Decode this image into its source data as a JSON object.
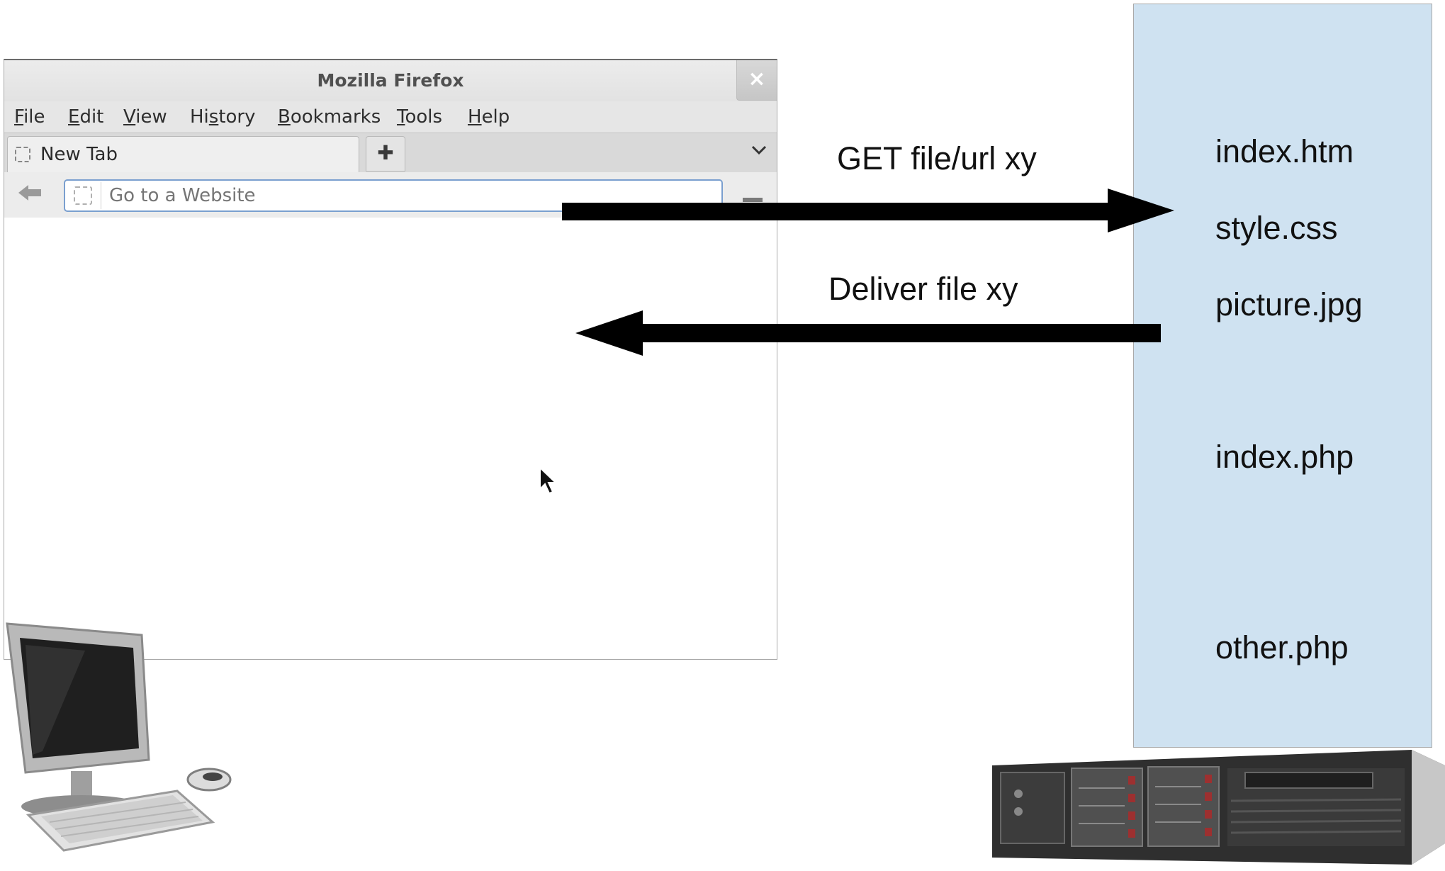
{
  "browser": {
    "window_title": "Mozilla Firefox",
    "close_glyph": "×",
    "menu": [
      {
        "accel": "F",
        "rest": "ile"
      },
      {
        "accel": "E",
        "rest": "dit"
      },
      {
        "accel": "V",
        "rest": "iew"
      },
      {
        "pre": "Hi",
        "accel": "s",
        "rest": "tory"
      },
      {
        "accel": "B",
        "rest": "ookmarks"
      },
      {
        "accel": "T",
        "rest": "ools"
      },
      {
        "accel": "H",
        "rest": "elp"
      }
    ],
    "tab_label": "New Tab",
    "new_tab_glyph": "✚",
    "tab_list_glyph": "⌄",
    "back_glyph": "🡄",
    "url_placeholder": "Go to a Website",
    "icons": [
      "close-icon",
      "new-tab-icon",
      "tab-list-icon",
      "back-arrow-icon",
      "page-favicon-icon",
      "mouse-cursor-icon"
    ]
  },
  "arrows": {
    "request_label": "GET file/url xy",
    "response_label": "Deliver file xy"
  },
  "server": {
    "files": [
      "index.htm",
      "style.css",
      "picture.jpg",
      "index.php",
      "other.php"
    ],
    "column_color": "#cfe2f1"
  }
}
